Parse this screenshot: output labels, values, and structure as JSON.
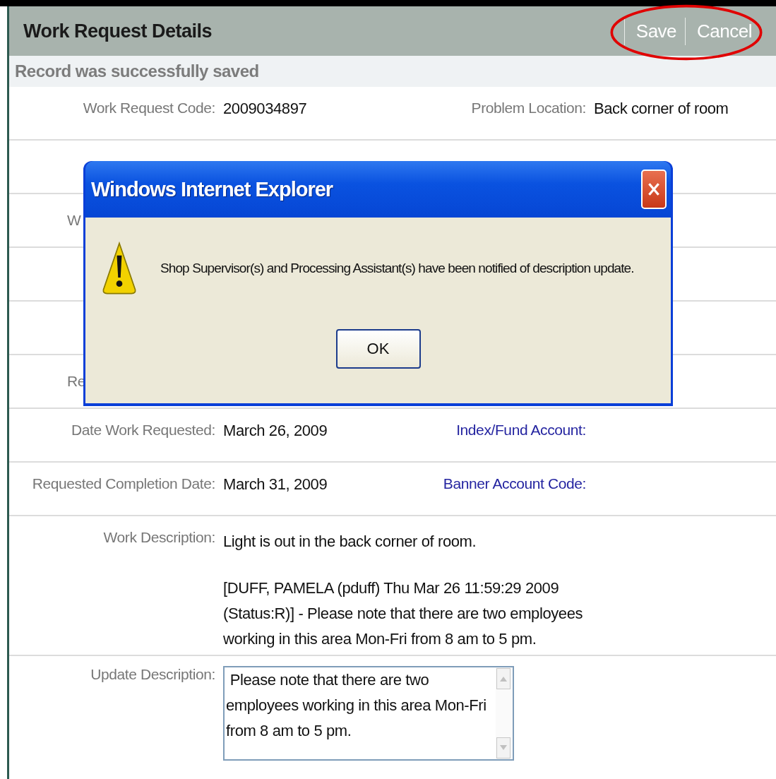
{
  "header": {
    "title": "Work Request Details",
    "actions": [
      {
        "label": "Save"
      },
      {
        "label": "Cancel"
      }
    ]
  },
  "status_message": "Record was successfully saved",
  "rows": [
    {
      "kind": "pair",
      "label": "Work Request Code:",
      "value": "2009034897",
      "right_label": "Problem Location:",
      "right_value": "Back corner of room",
      "right_link": false
    },
    {
      "kind": "covered"
    },
    {
      "kind": "covered",
      "label": "W"
    },
    {
      "kind": "covered"
    },
    {
      "kind": "covered"
    },
    {
      "kind": "covered",
      "label": "Re"
    },
    {
      "kind": "pair",
      "label": "Date Work Requested:",
      "value": "March 26, 2009",
      "right_label": "Index/Fund Account:",
      "right_link": true
    },
    {
      "kind": "pair",
      "label": "Requested Completion Date:",
      "value": "March 31, 2009",
      "right_label": "Banner Account Code:",
      "right_link": true
    },
    {
      "kind": "text",
      "label": "Work Description:",
      "paragraphs": [
        "Light is out in the back corner of room.",
        "[DUFF, PAMELA (pduff) Thu Mar 26 11:59:29 2009 (Status:R)] - Please note that there are two employees working in this area Mon-Fri from 8 am to 5 pm."
      ]
    },
    {
      "kind": "textarea",
      "label": "Update Description:",
      "value": " Please note that there are two employees working in this area Mon-Fri from 8 am to 5 pm."
    }
  ],
  "dialog": {
    "title": "Windows Internet Explorer",
    "message": "Shop Supervisor(s) and Processing Assistant(s) have been notified of description update.",
    "button": "OK"
  }
}
